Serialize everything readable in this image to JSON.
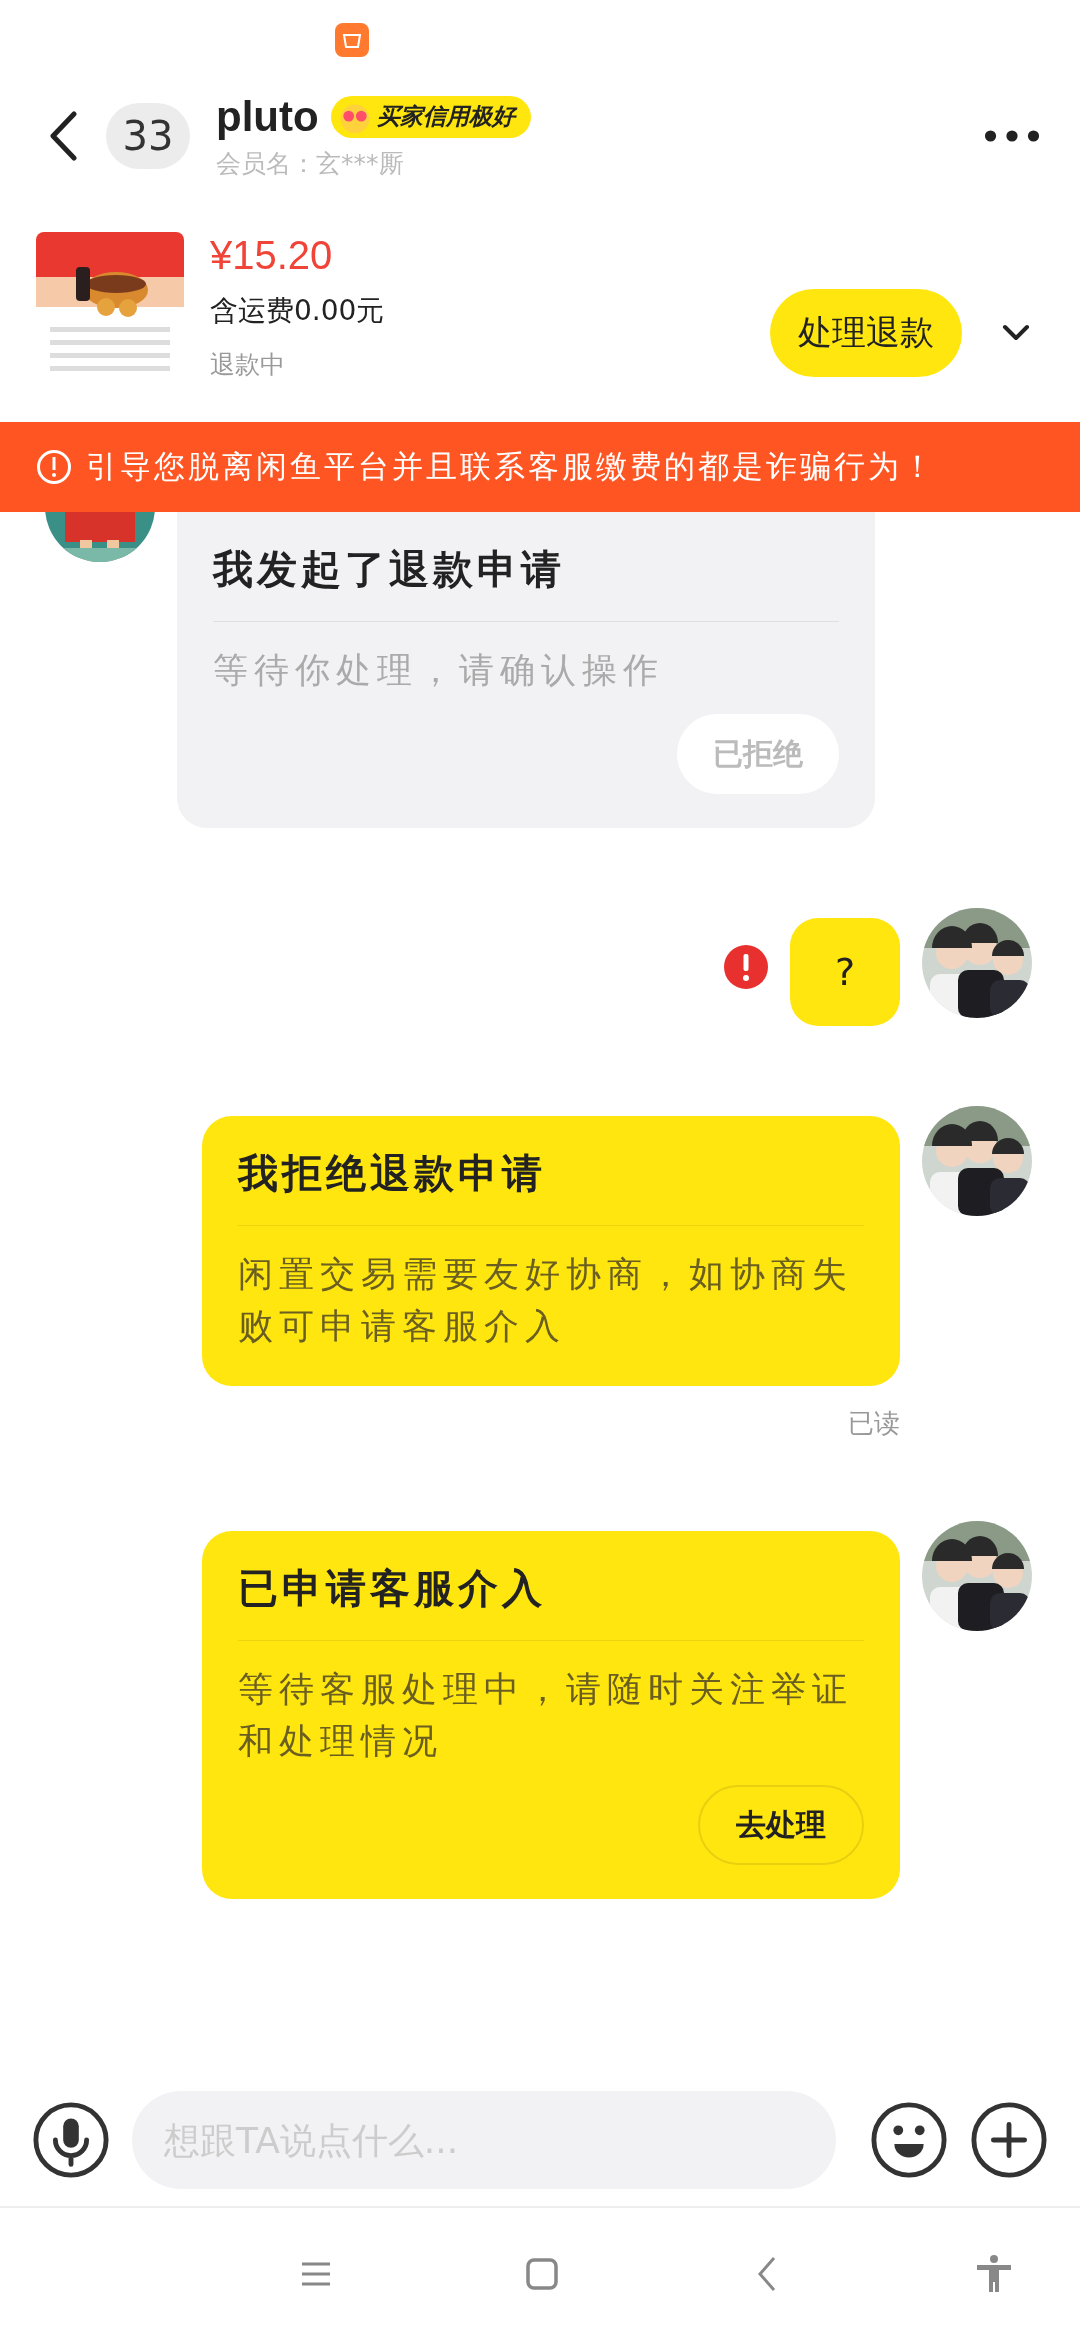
{
  "header": {
    "unread_count": "33",
    "name": "pluto",
    "credit_badge": "买家信用极好",
    "member_label": "会员名：玄***厮"
  },
  "product": {
    "kind": "picture",
    "price": "¥15.20",
    "shipping": "含运费0.00元",
    "status": "退款中",
    "action_button": "处理退款"
  },
  "warning": "引导您脱离闲鱼平台并且联系客服缴费的都是诈骗行为！",
  "messages": [
    {
      "kind": "card",
      "mine": false,
      "title": "我发起了退款申请",
      "body": "等待你处理，请确认操作",
      "button": {
        "label": "已拒绝",
        "disabled": true
      }
    },
    {
      "kind": "text",
      "mine": true,
      "text": "?",
      "failed": true
    },
    {
      "kind": "card",
      "mine": true,
      "title": "我拒绝退款申请",
      "body": "闲置交易需要友好协商，如协商失败可申请客服介入",
      "read_receipt": "已读"
    },
    {
      "kind": "card",
      "mine": true,
      "title": "已申请客服介入",
      "body": "等待客服处理中，请随时关注举证和处理情况",
      "button": {
        "label": "去处理",
        "disabled": false
      }
    }
  ],
  "input": {
    "placeholder": "想跟TA说点什么..."
  }
}
